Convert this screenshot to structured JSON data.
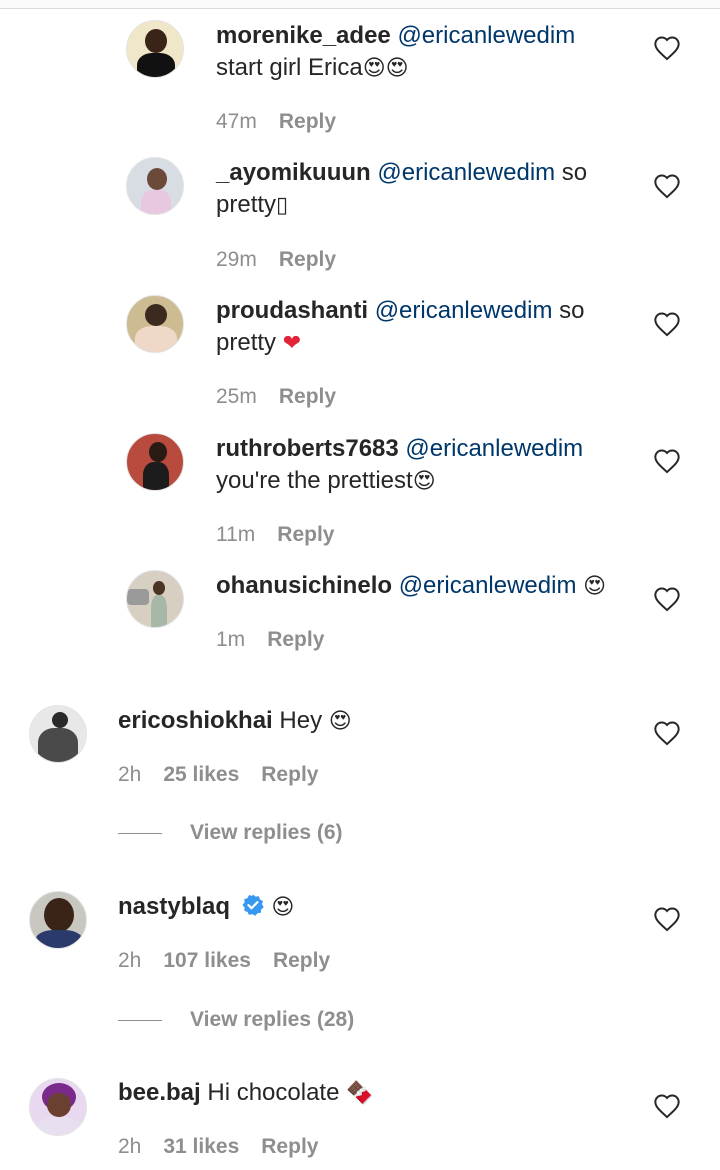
{
  "reply_label": "Reply",
  "comments": [
    {
      "username": "morenike_adee",
      "mention": "@ericanlewedim",
      "text_line1": "",
      "text_line2": "start girl Erica",
      "emoji": "😍😍",
      "time": "47m"
    },
    {
      "username": "_ayomikuuun",
      "mention": "@ericanlewedim",
      "text_line1": " so",
      "text_line2": "pretty",
      "emoji": "▯",
      "time": "29m"
    },
    {
      "username": "proudashanti",
      "mention": "@ericanlewedim",
      "text_line1": " so",
      "text_line2": "pretty ",
      "emoji": "❤",
      "time": "25m"
    },
    {
      "username": "ruthroberts7683",
      "mention": "@ericanlewedim",
      "text_line1": "",
      "text_line2": "you're the prettiest",
      "emoji": "😍",
      "time": "11m"
    },
    {
      "username": "ohanusichinelo",
      "mention": "@ericanlewedim",
      "text_line1": " ",
      "emoji": "😍",
      "time": "1m"
    },
    {
      "username": "ericoshiokhai",
      "text": " Hey ",
      "emoji": "😍",
      "time": "2h",
      "likes": "25 likes",
      "view_replies": "View replies (6)"
    },
    {
      "username": "nastyblaq",
      "emoji": "😍",
      "time": "2h",
      "likes": "107 likes",
      "view_replies": "View replies (28)"
    },
    {
      "username": "bee.baj",
      "text": " Hi chocolate ",
      "emoji": "🍫",
      "time": "2h",
      "likes": "31 likes"
    }
  ],
  "colors": {
    "mention": "#00376b",
    "meta": "#8e8e8e",
    "verified": "#3897f0",
    "heart": "#e0243a"
  }
}
